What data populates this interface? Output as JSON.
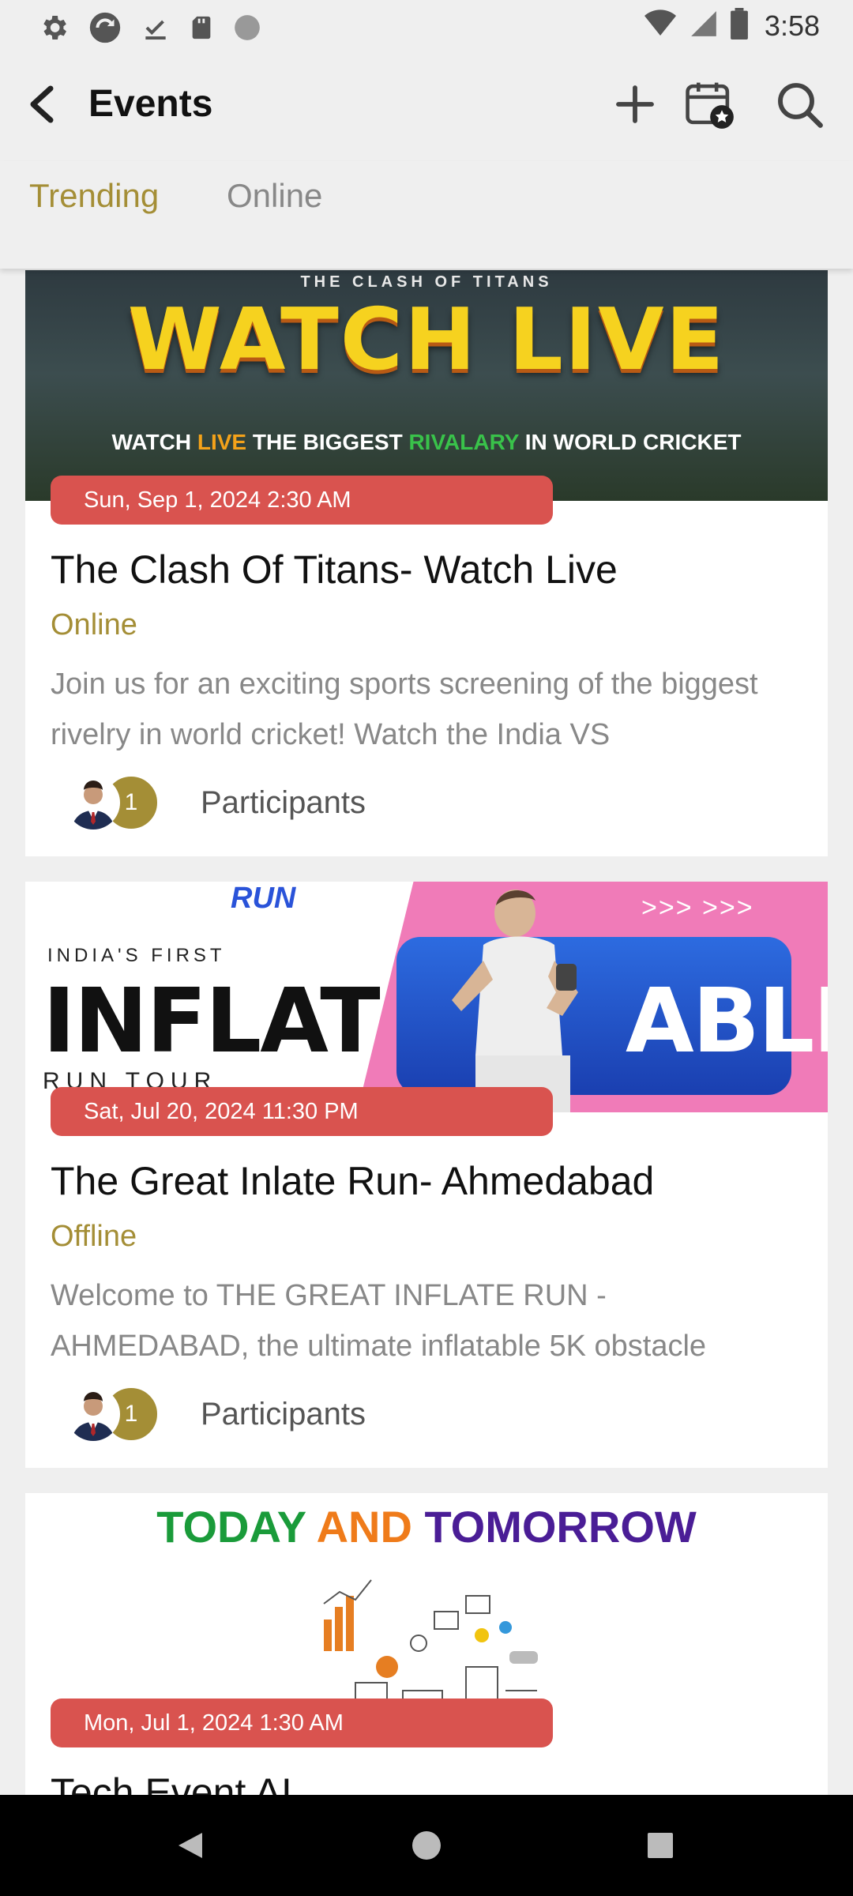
{
  "status_bar": {
    "time": "3:58",
    "left_icons": [
      "settings-icon",
      "sync-icon",
      "download-done-icon",
      "sd-card-icon",
      "circle-status-icon"
    ],
    "right_icons": [
      "wifi-icon",
      "cell-signal-icon",
      "battery-icon"
    ]
  },
  "app_bar": {
    "title": "Events",
    "actions": [
      "add-icon",
      "calendar-star-icon",
      "search-icon"
    ]
  },
  "tabs": [
    {
      "label": "Trending",
      "active": true
    },
    {
      "label": "Online",
      "active": false
    }
  ],
  "events": [
    {
      "date": "Sun, Sep 1, 2024 2:30 AM",
      "title": "The Clash Of Titans- Watch Live",
      "mode": "Online",
      "description": "Join us for an exciting sports screening of the biggest rivelry in world cricket! Watch the India VS",
      "participant_count": "1",
      "participants_label": "Participants",
      "banner": {
        "kicker": "THE CLASH OF TITANS",
        "headline": "WATCH LIVE",
        "strap_a": "WATCH ",
        "strap_b": "LIVE",
        "strap_c": " THE BIGGEST ",
        "strap_d": "RIVALARY",
        "strap_e": " IN WORLD CRICKET"
      }
    },
    {
      "date": "Sat, Jul 20, 2024 11:30 PM",
      "title": "The Great Inlate Run- Ahmedabad",
      "mode": "Offline",
      "description": "Welcome to THE GREAT INFLATE RUN - AHMEDABAD, the ultimate inflatable 5K obstacle",
      "participant_count": "1",
      "participants_label": "Participants",
      "banner": {
        "run": "RUN",
        "india": "INDIA'S FIRST",
        "inflat": "INFLAT",
        "able": "ABLE",
        "tour": "RUN TOUR",
        "arrows": ">>> >>>"
      }
    },
    {
      "date": "Mon, Jul 1, 2024 1:30 AM",
      "title": "Tech Event AI",
      "banner": {
        "w1": "TODAY ",
        "w2": "AND ",
        "w3": "TOMORROW"
      }
    }
  ],
  "nav_bar": {
    "buttons": [
      "back-triangle-icon",
      "home-circle-icon",
      "recents-square-icon"
    ]
  },
  "colors": {
    "accent": "#a48e36",
    "date_pill": "#d9534f",
    "background": "#efefef"
  }
}
